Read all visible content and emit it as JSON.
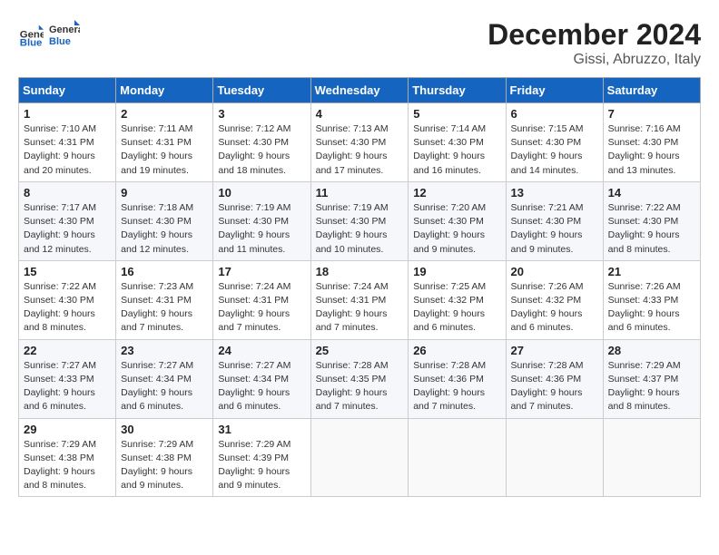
{
  "header": {
    "logo_general": "General",
    "logo_blue": "Blue",
    "month_title": "December 2024",
    "location": "Gissi, Abruzzo, Italy"
  },
  "weekdays": [
    "Sunday",
    "Monday",
    "Tuesday",
    "Wednesday",
    "Thursday",
    "Friday",
    "Saturday"
  ],
  "weeks": [
    [
      {
        "day": "1",
        "info": "Sunrise: 7:10 AM\nSunset: 4:31 PM\nDaylight: 9 hours\nand 20 minutes."
      },
      {
        "day": "2",
        "info": "Sunrise: 7:11 AM\nSunset: 4:31 PM\nDaylight: 9 hours\nand 19 minutes."
      },
      {
        "day": "3",
        "info": "Sunrise: 7:12 AM\nSunset: 4:30 PM\nDaylight: 9 hours\nand 18 minutes."
      },
      {
        "day": "4",
        "info": "Sunrise: 7:13 AM\nSunset: 4:30 PM\nDaylight: 9 hours\nand 17 minutes."
      },
      {
        "day": "5",
        "info": "Sunrise: 7:14 AM\nSunset: 4:30 PM\nDaylight: 9 hours\nand 16 minutes."
      },
      {
        "day": "6",
        "info": "Sunrise: 7:15 AM\nSunset: 4:30 PM\nDaylight: 9 hours\nand 14 minutes."
      },
      {
        "day": "7",
        "info": "Sunrise: 7:16 AM\nSunset: 4:30 PM\nDaylight: 9 hours\nand 13 minutes."
      }
    ],
    [
      {
        "day": "8",
        "info": "Sunrise: 7:17 AM\nSunset: 4:30 PM\nDaylight: 9 hours\nand 12 minutes."
      },
      {
        "day": "9",
        "info": "Sunrise: 7:18 AM\nSunset: 4:30 PM\nDaylight: 9 hours\nand 12 minutes."
      },
      {
        "day": "10",
        "info": "Sunrise: 7:19 AM\nSunset: 4:30 PM\nDaylight: 9 hours\nand 11 minutes."
      },
      {
        "day": "11",
        "info": "Sunrise: 7:19 AM\nSunset: 4:30 PM\nDaylight: 9 hours\nand 10 minutes."
      },
      {
        "day": "12",
        "info": "Sunrise: 7:20 AM\nSunset: 4:30 PM\nDaylight: 9 hours\nand 9 minutes."
      },
      {
        "day": "13",
        "info": "Sunrise: 7:21 AM\nSunset: 4:30 PM\nDaylight: 9 hours\nand 9 minutes."
      },
      {
        "day": "14",
        "info": "Sunrise: 7:22 AM\nSunset: 4:30 PM\nDaylight: 9 hours\nand 8 minutes."
      }
    ],
    [
      {
        "day": "15",
        "info": "Sunrise: 7:22 AM\nSunset: 4:30 PM\nDaylight: 9 hours\nand 8 minutes."
      },
      {
        "day": "16",
        "info": "Sunrise: 7:23 AM\nSunset: 4:31 PM\nDaylight: 9 hours\nand 7 minutes."
      },
      {
        "day": "17",
        "info": "Sunrise: 7:24 AM\nSunset: 4:31 PM\nDaylight: 9 hours\nand 7 minutes."
      },
      {
        "day": "18",
        "info": "Sunrise: 7:24 AM\nSunset: 4:31 PM\nDaylight: 9 hours\nand 7 minutes."
      },
      {
        "day": "19",
        "info": "Sunrise: 7:25 AM\nSunset: 4:32 PM\nDaylight: 9 hours\nand 6 minutes."
      },
      {
        "day": "20",
        "info": "Sunrise: 7:26 AM\nSunset: 4:32 PM\nDaylight: 9 hours\nand 6 minutes."
      },
      {
        "day": "21",
        "info": "Sunrise: 7:26 AM\nSunset: 4:33 PM\nDaylight: 9 hours\nand 6 minutes."
      }
    ],
    [
      {
        "day": "22",
        "info": "Sunrise: 7:27 AM\nSunset: 4:33 PM\nDaylight: 9 hours\nand 6 minutes."
      },
      {
        "day": "23",
        "info": "Sunrise: 7:27 AM\nSunset: 4:34 PM\nDaylight: 9 hours\nand 6 minutes."
      },
      {
        "day": "24",
        "info": "Sunrise: 7:27 AM\nSunset: 4:34 PM\nDaylight: 9 hours\nand 6 minutes."
      },
      {
        "day": "25",
        "info": "Sunrise: 7:28 AM\nSunset: 4:35 PM\nDaylight: 9 hours\nand 7 minutes."
      },
      {
        "day": "26",
        "info": "Sunrise: 7:28 AM\nSunset: 4:36 PM\nDaylight: 9 hours\nand 7 minutes."
      },
      {
        "day": "27",
        "info": "Sunrise: 7:28 AM\nSunset: 4:36 PM\nDaylight: 9 hours\nand 7 minutes."
      },
      {
        "day": "28",
        "info": "Sunrise: 7:29 AM\nSunset: 4:37 PM\nDaylight: 9 hours\nand 8 minutes."
      }
    ],
    [
      {
        "day": "29",
        "info": "Sunrise: 7:29 AM\nSunset: 4:38 PM\nDaylight: 9 hours\nand 8 minutes."
      },
      {
        "day": "30",
        "info": "Sunrise: 7:29 AM\nSunset: 4:38 PM\nDaylight: 9 hours\nand 9 minutes."
      },
      {
        "day": "31",
        "info": "Sunrise: 7:29 AM\nSunset: 4:39 PM\nDaylight: 9 hours\nand 9 minutes."
      },
      {
        "day": "",
        "info": ""
      },
      {
        "day": "",
        "info": ""
      },
      {
        "day": "",
        "info": ""
      },
      {
        "day": "",
        "info": ""
      }
    ]
  ]
}
